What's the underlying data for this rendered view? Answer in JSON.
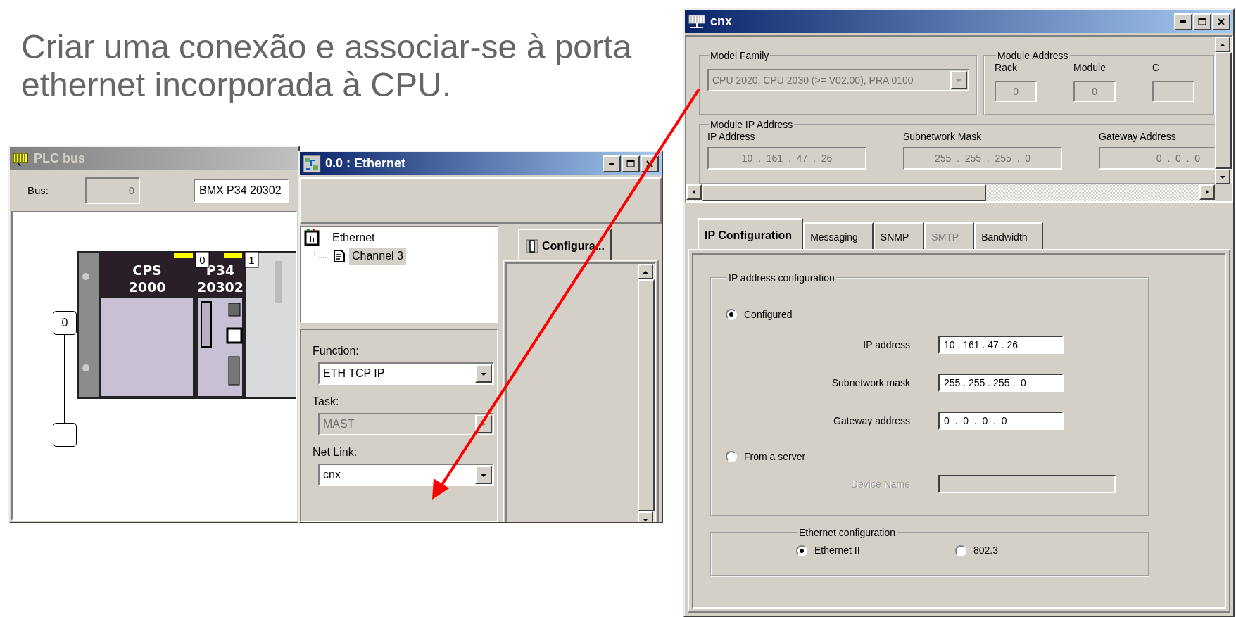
{
  "slide": {
    "heading": "Criar uma conexão e associar-se à porta ethernet incorporada à CPU."
  },
  "plc_bus_window": {
    "title": "PLC bus",
    "active": false,
    "bus_label": "Bus:",
    "bus_value": "0",
    "rack_reference": "BMX P34 20302",
    "bus_node": "0",
    "modules": [
      {
        "lines": [
          "CPS",
          "2000"
        ]
      },
      {
        "lines": [
          "P34",
          "20302"
        ]
      }
    ],
    "slots": [
      "0",
      "1"
    ]
  },
  "ethernet_window": {
    "title": "0.0 : Ethernet",
    "active": true,
    "tree": [
      {
        "label": "Ethernet",
        "selected": false,
        "children": [
          {
            "label": "Channel 3",
            "selected": true
          }
        ]
      }
    ],
    "fields": [
      {
        "label": "Function:",
        "value": "ETH TCP IP",
        "disabled": false
      },
      {
        "label": "Task:",
        "value": "MAST",
        "disabled": true
      },
      {
        "label": "Net Link:",
        "value": "cnx",
        "disabled": false
      }
    ],
    "tab": "Configura..."
  },
  "cnx_window": {
    "title": "cnx",
    "active": true,
    "model_family": {
      "legend": "Model Family",
      "value": "CPU 2020, CPU 2030 (>= V02.00), PRA 0100",
      "disabled": true
    },
    "module_address": {
      "legend": "Module Address",
      "disabled": true,
      "fields": [
        {
          "label": "Rack",
          "value": "0"
        },
        {
          "label": "Module",
          "value": "0"
        },
        {
          "label": "C"
        }
      ]
    },
    "module_ip_address": {
      "legend": "Module IP Address",
      "disabled": true,
      "fields": [
        {
          "label": "IP Address",
          "value": "10  .  161  .  47  .  26"
        },
        {
          "label": "Subnetwork Mask",
          "value": "255  .  255  .  255  .  0"
        },
        {
          "label": "Gateway Address",
          "value": "0  .  0  .  0"
        }
      ]
    },
    "tabs": [
      {
        "label": "IP Configuration",
        "selected": true,
        "disabled": false
      },
      {
        "label": "Messaging",
        "selected": false,
        "disabled": false
      },
      {
        "label": "SNMP",
        "selected": false,
        "disabled": false
      },
      {
        "label": "SMTP",
        "selected": false,
        "disabled": true
      },
      {
        "label": "Bandwidth",
        "selected": false,
        "disabled": false
      }
    ],
    "ip_address_configuration": {
      "legend": "IP address configuration",
      "options": [
        {
          "label": "Configured",
          "selected": true,
          "fields": [
            {
              "label": "IP address",
              "value": "10 . 161 . 47 . 26",
              "disabled": false
            },
            {
              "label": "Subnetwork mask",
              "value": "255 . 255 . 255 .  0",
              "disabled": false
            },
            {
              "label": "Gateway address",
              "value": "0  .  0  .  0  .  0",
              "disabled": false
            }
          ]
        },
        {
          "label": "From a server",
          "selected": false,
          "fields": [
            {
              "label": "Device Name",
              "disabled": true
            }
          ]
        }
      ]
    },
    "ethernet_configuration": {
      "legend": "Ethernet configuration",
      "options": [
        {
          "label": "Ethernet II",
          "selected": true
        },
        {
          "label": "802.3",
          "selected": false
        }
      ]
    }
  }
}
